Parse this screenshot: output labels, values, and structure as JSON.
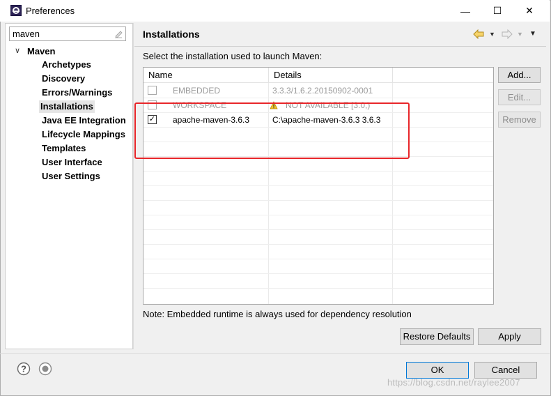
{
  "window": {
    "title": "Preferences",
    "minimize_symbol": "—",
    "maximize_symbol": "☐",
    "close_symbol": "✕"
  },
  "left": {
    "filter_value": "maven",
    "tree_root": "Maven",
    "tree_items": [
      {
        "label": "Archetypes"
      },
      {
        "label": "Discovery"
      },
      {
        "label": "Errors/Warnings"
      },
      {
        "label": "Installations",
        "selected": true
      },
      {
        "label": "Java EE Integration"
      },
      {
        "label": "Lifecycle Mappings"
      },
      {
        "label": "Templates"
      },
      {
        "label": "User Interface"
      },
      {
        "label": "User Settings"
      }
    ]
  },
  "right": {
    "page_title": "Installations",
    "prompt": "Select the installation used to launch Maven:",
    "columns": {
      "name": "Name",
      "details": "Details"
    },
    "rows": [
      {
        "name": "EMBEDDED",
        "details": "3.3.3/1.6.2.20150902-0001",
        "checked": false,
        "dim": true
      },
      {
        "name": "WORKSPACE",
        "details": "NOT AVAILABLE [3.0,)",
        "checked": false,
        "dim": true,
        "warning": true
      },
      {
        "name": "apache-maven-3.6.3",
        "details": "C:\\apache-maven-3.6.3 3.6.3",
        "checked": true,
        "dim": false
      }
    ],
    "side_buttons": {
      "add": "Add...",
      "edit": "Edit...",
      "remove": "Remove"
    },
    "note": "Note: Embedded runtime is always used for dependency resolution",
    "restore_defaults": "Restore Defaults",
    "apply": "Apply"
  },
  "footer": {
    "ok": "OK",
    "cancel": "Cancel",
    "watermark": "https://blog.csdn.net/raylee2007"
  },
  "colors": {
    "highlight_box": "#e8262a",
    "selection": "#e5e5e5",
    "ok_border": "#0078d7"
  },
  "icons": [
    "eclipse-app-icon",
    "clear-filter-icon",
    "back-icon",
    "forward-icon",
    "menu-icon",
    "warning-icon",
    "help-icon",
    "record-icon"
  ]
}
